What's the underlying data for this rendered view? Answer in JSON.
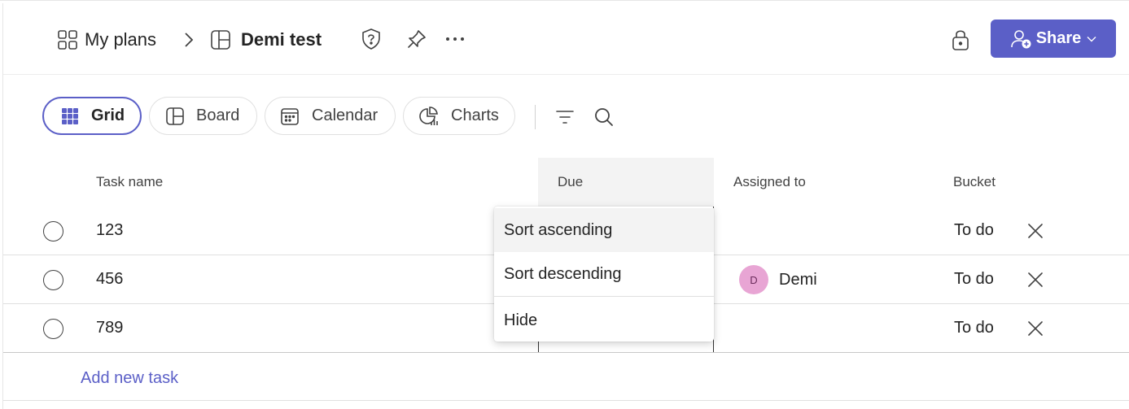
{
  "breadcrumb": {
    "my_plans": "My plans",
    "plan_name": "Demi test"
  },
  "header": {
    "share_label": "Share",
    "icons": [
      "my-plans-grid-icon",
      "chevron-right-icon",
      "plan-icon",
      "shield-question-icon",
      "pin-icon",
      "more-icon",
      "lock-icon",
      "person-add-icon",
      "chevron-down-icon"
    ]
  },
  "views": {
    "tabs": [
      {
        "label": "Grid",
        "icon": "grid-icon",
        "active": true
      },
      {
        "label": "Board",
        "icon": "board-icon",
        "active": false
      },
      {
        "label": "Calendar",
        "icon": "calendar-icon",
        "active": false
      },
      {
        "label": "Charts",
        "icon": "charts-icon",
        "active": false
      }
    ],
    "tools": [
      "filter-icon",
      "search-icon"
    ]
  },
  "grid": {
    "columns": {
      "task_name": "Task name",
      "due": "Due",
      "assigned_to": "Assigned to",
      "bucket": "Bucket"
    },
    "rows": [
      {
        "name": "123",
        "assignee": "",
        "assignee_initial": "",
        "bucket": "To do"
      },
      {
        "name": "456",
        "assignee": "Demi",
        "assignee_initial": "D",
        "bucket": "To do"
      },
      {
        "name": "789",
        "assignee": "",
        "assignee_initial": "",
        "bucket": "To do"
      }
    ],
    "add_task": "Add new task"
  },
  "column_menu": {
    "sort_ascending": "Sort ascending",
    "sort_descending": "Sort descending",
    "hide": "Hide"
  },
  "colors": {
    "accent": "#5b5fc7",
    "avatar_bg": "#e8a5d4"
  }
}
